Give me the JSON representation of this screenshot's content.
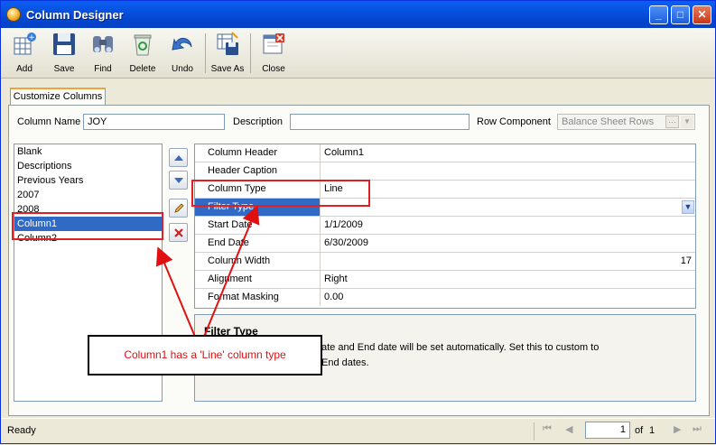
{
  "window": {
    "title": "Column Designer",
    "minimize": "_",
    "maximize": "□",
    "close": "✕"
  },
  "toolbar": {
    "items": [
      {
        "label": "Add",
        "icon": "add-grid-icon"
      },
      {
        "label": "Save",
        "icon": "floppy-disk-icon"
      },
      {
        "label": "Find",
        "icon": "binoculars-icon"
      },
      {
        "label": "Delete",
        "icon": "recycle-bin-icon"
      },
      {
        "label": "Undo",
        "icon": "undo-arrow-icon"
      },
      {
        "label": "Save As",
        "icon": "save-as-icon"
      },
      {
        "label": "Close",
        "icon": "close-window-icon"
      }
    ]
  },
  "tabs": [
    {
      "label": "Customize Columns",
      "active": true
    }
  ],
  "form": {
    "column_name_label": "Column Name",
    "column_name_value": "JOY",
    "description_label": "Description",
    "description_value": "",
    "row_component_label": "Row Component",
    "row_component_value": "Balance Sheet Rows",
    "ellipsis": "···"
  },
  "columns_list": {
    "items": [
      "Blank",
      "Descriptions",
      "Previous Years",
      "2007",
      "2008",
      "Column1",
      "Column2"
    ],
    "selected": "Column1"
  },
  "side_buttons": [
    {
      "icon": "move-up-icon"
    },
    {
      "icon": "move-down-icon"
    },
    {
      "icon": "edit-pencil-icon"
    },
    {
      "icon": "delete-x-icon"
    }
  ],
  "properties": {
    "rows": [
      {
        "key": "Column Header",
        "value": "Column1"
      },
      {
        "key": "Header Caption",
        "value": ""
      },
      {
        "key": "Column Type",
        "value": "Line"
      },
      {
        "key": "Filter Type",
        "value": ""
      },
      {
        "key": "Start Date",
        "value": "1/1/2009"
      },
      {
        "key": "End Date",
        "value": "6/30/2009"
      },
      {
        "key": "Column Width",
        "value": "17"
      },
      {
        "key": "Alignment",
        "value": "Right"
      },
      {
        "key": "Format Masking",
        "value": "0.00"
      }
    ],
    "selected_row": "Filter Type"
  },
  "description_panel": {
    "title": "Filter Type",
    "line1": "ate and End date will be set automatically. Set this to custom to",
    "line2": "End dates."
  },
  "annotation": {
    "callout_text": "Column1 has a 'Line' column type",
    "color": "#e01010"
  },
  "status": {
    "text": "Ready",
    "page_current": "1",
    "page_of_label": "of",
    "page_total": "1"
  }
}
